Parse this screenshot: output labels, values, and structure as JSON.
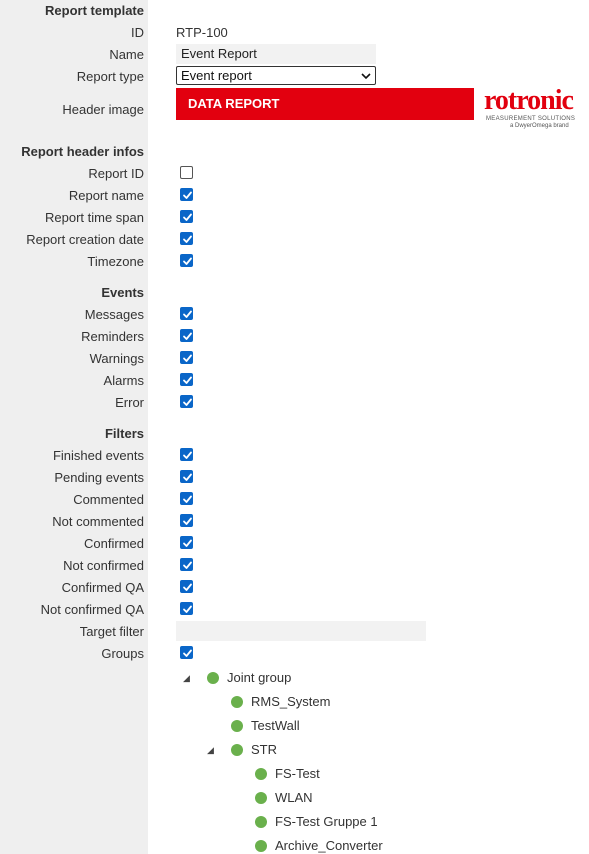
{
  "sections": {
    "report_template": "Report template",
    "report_header_infos": "Report header infos",
    "events": "Events",
    "filters": "Filters"
  },
  "template": {
    "id_label": "ID",
    "id_value": "RTP-100",
    "name_label": "Name",
    "name_value": "Event Report",
    "type_label": "Report type",
    "type_value": "Event report",
    "header_image_label": "Header image",
    "banner_text": "DATA REPORT",
    "logo_word": "rotronic",
    "logo_tag": "MEASUREMENT SOLUTIONS",
    "logo_brand": "a DwyerOmega brand"
  },
  "header_infos": [
    {
      "label": "Report ID",
      "checked": false
    },
    {
      "label": "Report name",
      "checked": true
    },
    {
      "label": "Report time span",
      "checked": true
    },
    {
      "label": "Report creation date",
      "checked": true
    },
    {
      "label": "Timezone",
      "checked": true
    }
  ],
  "events": [
    {
      "label": "Messages",
      "checked": true
    },
    {
      "label": "Reminders",
      "checked": true
    },
    {
      "label": "Warnings",
      "checked": true
    },
    {
      "label": "Alarms",
      "checked": true
    },
    {
      "label": "Error",
      "checked": true
    }
  ],
  "filters": [
    {
      "label": "Finished events",
      "checked": true
    },
    {
      "label": "Pending events",
      "checked": true
    },
    {
      "label": "Commented",
      "checked": true
    },
    {
      "label": "Not commented",
      "checked": true
    },
    {
      "label": "Confirmed",
      "checked": true
    },
    {
      "label": "Not confirmed",
      "checked": true
    },
    {
      "label": "Confirmed QA",
      "checked": true
    },
    {
      "label": "Not confirmed QA",
      "checked": true
    }
  ],
  "target_filter": {
    "label": "Target filter",
    "value": ""
  },
  "groups": {
    "label": "Groups",
    "checked": true
  },
  "tree": {
    "expanded_glyph": "◢",
    "nodes": [
      {
        "label": "Joint group",
        "expanded": true
      },
      {
        "label": "RMS_System"
      },
      {
        "label": "TestWall"
      },
      {
        "label": "STR",
        "expanded": true
      },
      {
        "label": "FS-Test"
      },
      {
        "label": "WLAN"
      },
      {
        "label": "FS-Test Gruppe 1"
      },
      {
        "label": "Archive_Converter"
      }
    ]
  },
  "colors": {
    "accent": "#0a66c8",
    "brand_red": "#e2000f",
    "group_dot": "#6ab04c",
    "label_panel": "#efefef"
  }
}
